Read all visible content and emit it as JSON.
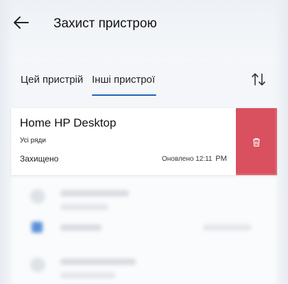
{
  "header": {
    "title": "Захист пристрою"
  },
  "tabs": [
    {
      "label": "Цей пристрій"
    },
    {
      "label": "Інші пристрої",
      "active": true
    }
  ],
  "device": {
    "name": "Home HP Desktop",
    "subtitle": "Усі ряди",
    "status": "Захищено",
    "updated": "Оновлено 12:11",
    "updated_suffix": "PM"
  },
  "icons": {
    "back": "arrow-left-icon",
    "sort": "sort-arrows-icon",
    "delete": "trash-icon"
  },
  "colors": {
    "accent": "#1f63b6",
    "delete": "#d9505f"
  }
}
